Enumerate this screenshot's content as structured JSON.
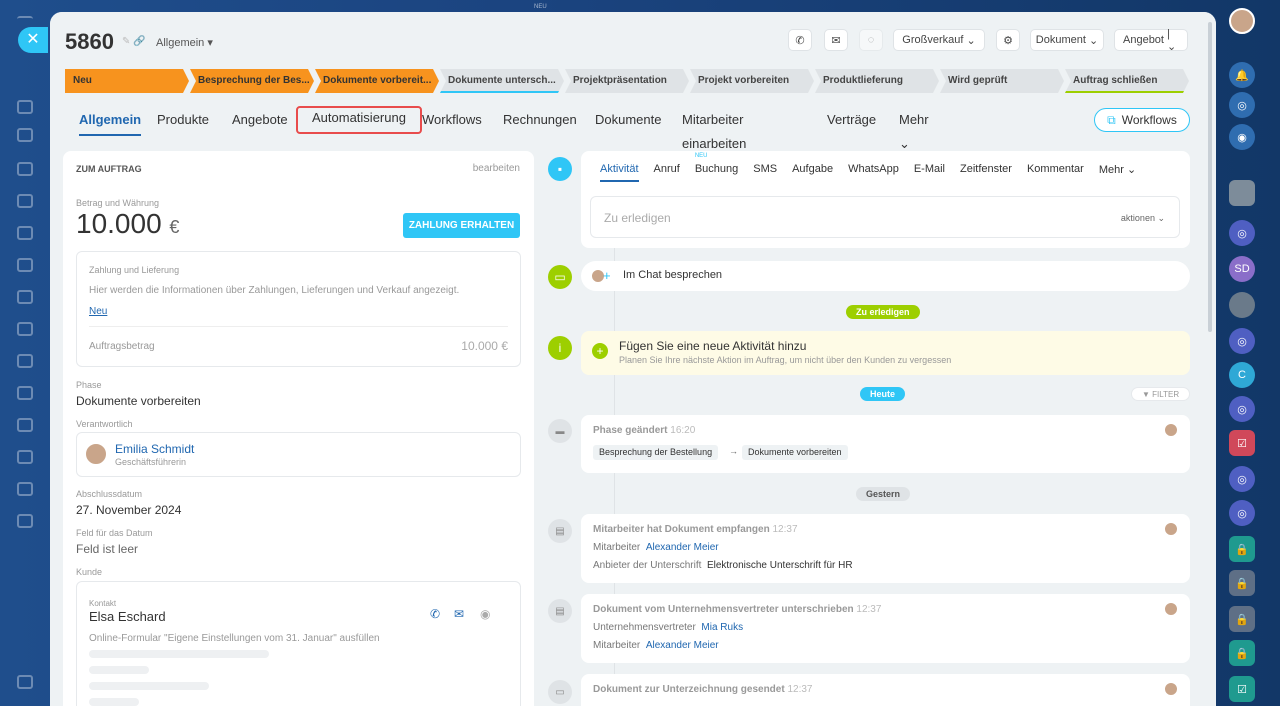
{
  "header": {
    "deal_number": "5860",
    "category": "Allgemein",
    "stage_label": "NEU"
  },
  "toolbar": {
    "grossverkauf": "Großverkauf",
    "dokument": "Dokument",
    "angebot": "Angebot"
  },
  "stages": [
    "Neu",
    "Besprechung der Bes...",
    "Dokumente vorbereit...",
    "Dokumente untersch...",
    "Projektpräsentation",
    "Projekt vorbereiten",
    "Produktlieferung",
    "Wird geprüft",
    "Auftrag schließen"
  ],
  "tabs": [
    "Allgemein",
    "Produkte",
    "Angebote",
    "Automatisierung",
    "Workflows",
    "Rechnungen",
    "Dokumente",
    "Mitarbeiter einarbeiten",
    "Verträge",
    "Mehr"
  ],
  "workflows_btn": "Workflows",
  "left": {
    "section_title": "ZUM AUFTRAG",
    "edit": "bearbeiten",
    "amount_label": "Betrag und Währung",
    "amount": "10.000",
    "currency": "€",
    "payment_btn": "ZAHLUNG ERHALTEN",
    "payment_title": "Zahlung und Lieferung",
    "payment_text": "Hier werden die Informationen über Zahlungen, Lieferungen und Verkauf angezeigt.",
    "payment_new": "Neu",
    "order_sum_label": "Auftragsbetrag",
    "order_sum": "10.000 €",
    "phase_label": "Phase",
    "phase": "Dokumente vorbereiten",
    "responsible_label": "Verantwortlich",
    "responsible_name": "Emilia Schmidt",
    "responsible_role": "Geschäftsführerin",
    "close_date_label": "Abschlussdatum",
    "close_date": "27. November 2024",
    "date_field_label": "Feld für das Datum",
    "date_field": "Feld ist leer",
    "client_label": "Kunde",
    "contact_label": "Kontakt",
    "contact_name": "Elsa Eschard",
    "form_text": "Online-Formular \"Eigene Einstellungen vom 31. Januar\" ausfüllen"
  },
  "activity_tabs": [
    "Aktivität",
    "Anruf",
    "Buchung",
    "SMS",
    "Aufgabe",
    "WhatsApp",
    "E-Mail",
    "Zeitfenster",
    "Kommentar",
    "Mehr"
  ],
  "buchung_badge": "NEU",
  "todo_placeholder": "Zu erledigen",
  "actions": "aktionen",
  "chat_text": "Im Chat besprechen",
  "pill_todo": "Zu erledigen",
  "add_activity_title": "Fügen Sie eine neue Aktivität hinzu",
  "add_activity_sub": "Planen Sie Ihre nächste Aktion im Auftrag, um nicht über den Kunden zu vergessen",
  "pill_today": "Heute",
  "filter": "FILTER",
  "phase_event": {
    "title": "Phase geändert",
    "time": "16:20",
    "from": "Besprechung der Bestellung",
    "to": "Dokumente vorbereiten"
  },
  "pill_yesterday": "Gestern",
  "event1": {
    "title": "Mitarbeiter hat Dokument empfangen",
    "time": "12:37",
    "k1": "Mitarbeiter",
    "v1": "Alexander Meier",
    "k2": "Anbieter der Unterschrift",
    "v2": "Elektronische Unterschrift für HR"
  },
  "event2": {
    "title": "Dokument vom Unternehmensvertreter unterschrieben",
    "time": "12:37",
    "k1": "Unternehmensvertreter",
    "v1": "Mia Ruks",
    "k2": "Mitarbeiter",
    "v2": "Alexander Meier"
  },
  "event3": {
    "title": "Dokument zur Unterzeichnung gesendet",
    "time": "12:37"
  },
  "colors": {
    "accent": "#2fc6f6",
    "orange": "#f7931e",
    "green": "#9dcf00",
    "link": "#2067b0",
    "highlight": "#e84c4c"
  }
}
